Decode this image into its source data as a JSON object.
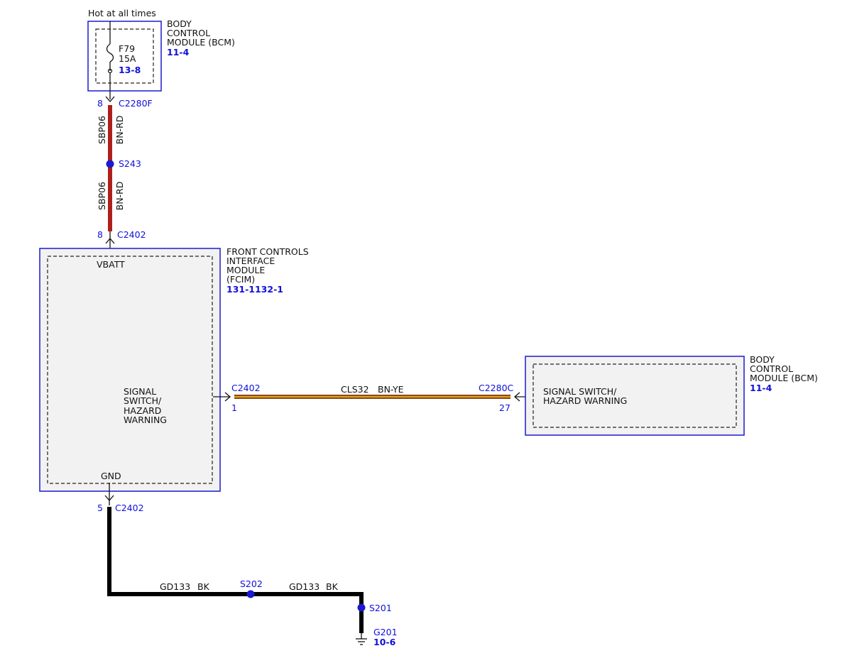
{
  "colors": {
    "module_border": "#1a1ad0",
    "link_text": "#1010d8",
    "wire_bn_rd": "#c0241e",
    "wire_bn_ye_outer": "#8a4a14",
    "wire_bn_ye_inner": "#e8a020",
    "wire_bk": "#000000",
    "splice_dot": "#1a1ad0",
    "module_fill": "#f2f2f2"
  },
  "power": {
    "label": "Hot at all times"
  },
  "bcm_top": {
    "name_lines": [
      "BODY",
      "CONTROL",
      "MODULE (BCM)"
    ],
    "ref": "11-4",
    "fuse": {
      "name": "F79",
      "rating": "15A",
      "ref": "13-8"
    }
  },
  "connectors": {
    "c2280f": {
      "id": "C2280F",
      "pin": "8"
    },
    "s243": "S243",
    "c2402_top": {
      "id": "C2402",
      "pin": "8"
    },
    "c2402_mid": {
      "id": "C2402",
      "pin": "1"
    },
    "c2280c": {
      "id": "C2280C",
      "pin": "27"
    },
    "c2402_bot": {
      "id": "C2402",
      "pin": "5"
    },
    "s202": "S202",
    "s201": "S201",
    "g201": {
      "id": "G201",
      "ref": "10-6"
    }
  },
  "wires": {
    "upper_1": {
      "circuit": "SBP06",
      "color": "BN-RD"
    },
    "upper_2": {
      "circuit": "SBP06",
      "color": "BN-RD"
    },
    "signal": {
      "circuit": "CLS32",
      "color": "BN-YE"
    },
    "ground_1": {
      "circuit": "GD133",
      "color": "BK"
    },
    "ground_2": {
      "circuit": "GD133",
      "color": "BK"
    }
  },
  "fcim": {
    "name_lines": [
      "FRONT CONTROLS",
      "INTERFACE",
      "MODULE",
      "(FCIM)"
    ],
    "ref": "131-1132-1",
    "vbatt": "VBATT",
    "gnd": "GND",
    "function_lines": [
      "SIGNAL",
      "SWITCH/",
      "HAZARD",
      "WARNING"
    ]
  },
  "bcm_right": {
    "name_lines": [
      "BODY",
      "CONTROL",
      "MODULE (BCM)"
    ],
    "ref": "11-4",
    "function_lines": [
      "SIGNAL SWITCH/",
      "HAZARD WARNING"
    ]
  }
}
